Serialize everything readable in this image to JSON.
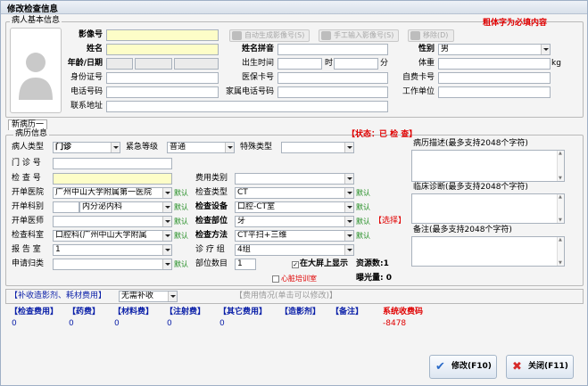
{
  "window": {
    "title": "修改检查信息"
  },
  "patient": {
    "legend": "病人基本信息",
    "required_note": "粗体字为必填内容",
    "labels": {
      "image_no": "影像号",
      "name": "姓名",
      "name_pinyin": "姓名拼音",
      "gender": "性别",
      "age_date": "年龄/日期",
      "birth_time": "出生时间",
      "hour": "时",
      "minute": "分",
      "weight": "体重",
      "weight_unit": "kg",
      "id_card": "身份证号",
      "insurance_card": "医保卡号",
      "self_pay_card": "自费卡号",
      "phone": "电话号码",
      "home_phone": "家属电话号码",
      "work_unit": "工作单位",
      "address": "联系地址"
    },
    "gender_value": "男",
    "toolbar": {
      "auto_generate": "自动生成影像号(S)",
      "manual_input": "手工输入影像号(S)",
      "remove": "移除(D)"
    }
  },
  "tab": {
    "label": "新病历一"
  },
  "record": {
    "legend": "病历信息",
    "status": "【状态：已  检  查】",
    "labels": {
      "patient_type": "病人类型",
      "urgency": "紧急等级",
      "special_type": "特殊类型",
      "clinic_no": "门 诊 号",
      "exam_no": "检 查 号",
      "fee_type": "费用类别",
      "order_hospital": "开单医院",
      "exam_type": "检查类型",
      "order_dept": "开单科别",
      "exam_device": "检查设备",
      "order_doctor": "开单医师",
      "exam_part": "检查部位",
      "exam_room": "检查科室",
      "exam_method": "检查方法",
      "report_room": "报 告 室",
      "diag_group": "诊 疗 组",
      "request_class": "申请归类",
      "part_count": "部位数目"
    },
    "values": {
      "patient_type": "门诊",
      "urgency": "普通",
      "order_hospital": "广州中山大学附属第一医院",
      "exam_type": "CT",
      "order_dept": "内分泌内科",
      "exam_device": "口腔-CT室",
      "exam_part": "牙",
      "exam_room": "口腔科(广州中山大学附属",
      "exam_method": "CT平扫+三维",
      "report_room": "1",
      "diag_group": "4组",
      "part_count": "1"
    },
    "default_label": "默认",
    "select_label": "【选择】",
    "big_screen": "在大屏上显示",
    "resource_count": "资源数:1",
    "heart_training": "心脏培训室",
    "exposure": "曝光量: 0",
    "desc_label": "病历描述(最多支持2048个字符)",
    "diag_label": "临床诊断(最多支持2048个字符)",
    "remark_label": "备注(最多支持2048个字符)"
  },
  "fee": {
    "supplement_label": "【补收造影剂、耗材费用】",
    "supplement_value": "无需补收",
    "fee_status": "【费用情况(单击可以修改)】",
    "columns": [
      "【检查费用】",
      "【药费】",
      "【材料费】",
      "【注射费】",
      "【其它费用】",
      "【造影剂】",
      "【备注】"
    ],
    "values": [
      "0",
      "0",
      "0",
      "0",
      "0"
    ],
    "system_fee_label": "系统收费码",
    "system_fee_value": "-8478"
  },
  "buttons": {
    "modify": "修改(F10)",
    "close": "关闭(F11)"
  },
  "colors": {
    "accent_red": "#e00000",
    "accent_blue": "#0a1fa8",
    "default_green": "#1b8a1b",
    "required_yellow": "#fdfdc8"
  }
}
